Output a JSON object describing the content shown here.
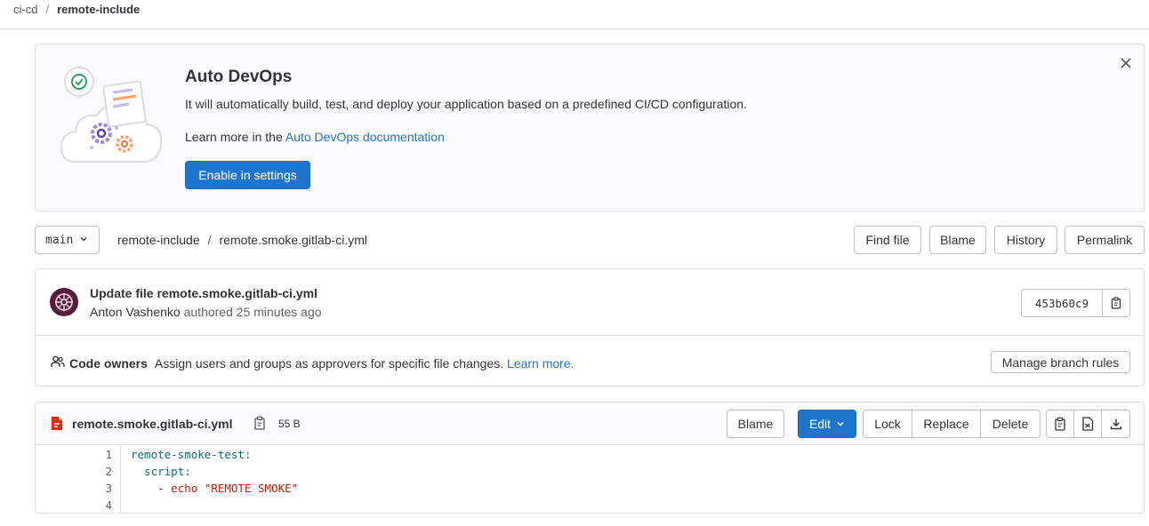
{
  "breadcrumb": {
    "group": "ci-cd",
    "separator": "/",
    "project": "remote-include"
  },
  "banner": {
    "title": "Auto DevOps",
    "description": "It will automatically build, test, and deploy your application based on a predefined CI/CD configuration.",
    "learn_prefix": "Learn more in the",
    "learn_link": "Auto DevOps documentation",
    "button": "Enable in settings",
    "close_icon": "close-icon"
  },
  "nav": {
    "branch": "main",
    "path": [
      "remote-include",
      "remote.smoke.gitlab-ci.yml"
    ],
    "path_separator": "/",
    "buttons": {
      "find_file": "Find file",
      "blame": "Blame",
      "history": "History",
      "permalink": "Permalink"
    }
  },
  "commit": {
    "title": "Update file remote.smoke.gitlab-ci.yml",
    "author": "Anton Vashenko",
    "action": "authored",
    "time": "25 minutes ago",
    "sha": "453b60c9"
  },
  "code_owners": {
    "title": "Code owners",
    "description": "Assign users and groups as approvers for specific file changes.",
    "link": "Learn more.",
    "button": "Manage branch rules"
  },
  "file": {
    "name": "remote.smoke.gitlab-ci.yml",
    "size": "55 B",
    "buttons": {
      "blame": "Blame",
      "edit": "Edit",
      "lock": "Lock",
      "replace": "Replace",
      "delete": "Delete"
    },
    "line_numbers": [
      "1",
      "2",
      "3",
      "4"
    ],
    "lines": [
      {
        "key": "remote-smoke-test",
        "colon": ":"
      },
      {
        "indent": "  ",
        "key": "script",
        "colon": ":"
      },
      {
        "indent": "    ",
        "dash": "- ",
        "value": "echo \"REMOTE SMOKE\""
      },
      {
        "indent": ""
      }
    ]
  },
  "colors": {
    "primary": "#1f75cb",
    "yaml_key": "#0b6a76",
    "yaml_string": "#c91c00",
    "file_icon": "#dd2b0e"
  }
}
